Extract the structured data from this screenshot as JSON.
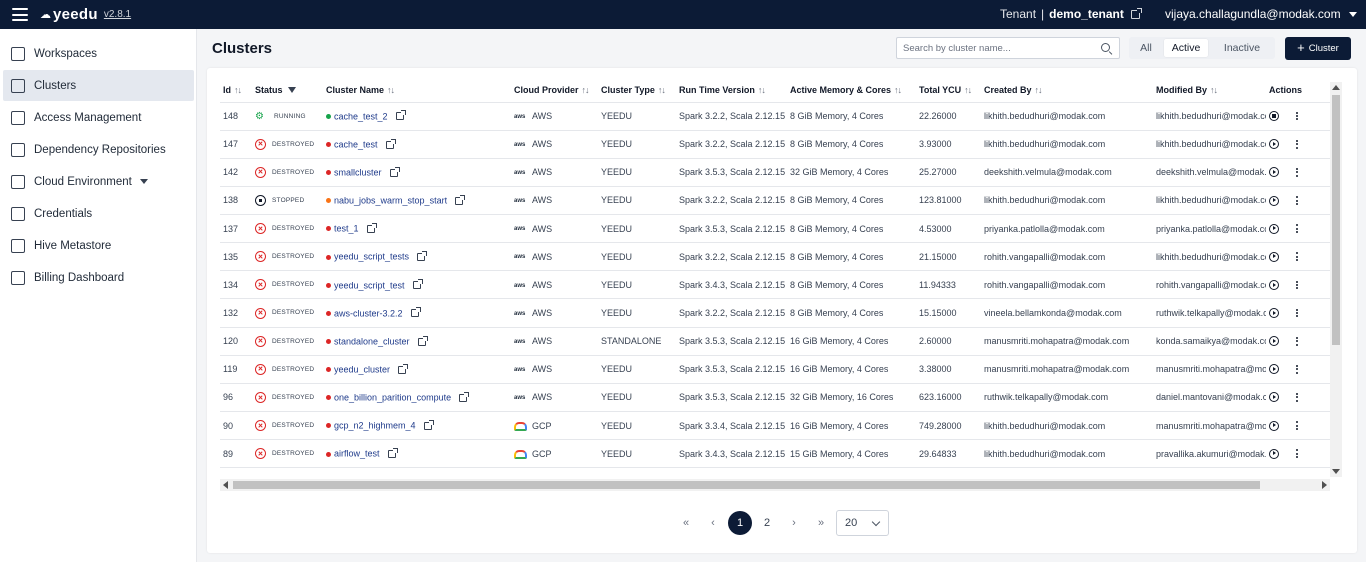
{
  "header": {
    "app_name": "yeedu",
    "version": "v2.8.1",
    "tenant_label": "Tenant",
    "tenant_sep": "|",
    "tenant_name": "demo_tenant",
    "user_email": "vijaya.challagundla@modak.com"
  },
  "sidebar": {
    "items": [
      {
        "label": "Workspaces",
        "icon": "workspace-icon"
      },
      {
        "label": "Clusters",
        "icon": "chart-icon",
        "active": true
      },
      {
        "label": "Access Management",
        "icon": "id-card-icon"
      },
      {
        "label": "Dependency Repositories",
        "icon": "repository-icon"
      },
      {
        "label": "Cloud Environment",
        "icon": "cloud-icon",
        "expandable": true
      },
      {
        "label": "Credentials",
        "icon": "lock-icon"
      },
      {
        "label": "Hive Metastore",
        "icon": "bank-icon"
      },
      {
        "label": "Billing Dashboard",
        "icon": "receipt-icon"
      }
    ]
  },
  "main": {
    "title": "Clusters",
    "search_placeholder": "Search by cluster name...",
    "filters": [
      "All",
      "Active",
      "Inactive"
    ],
    "selected_filter": "Active",
    "add_button": "Cluster",
    "columns": [
      "Id",
      "Status",
      "Cluster Name",
      "Cloud Provider",
      "Cluster Type",
      "Run Time Version",
      "Active Memory & Cores",
      "Total YCU",
      "Created By",
      "Modified By",
      "Actions"
    ],
    "rows": [
      {
        "id": "148",
        "status": "RUNNING",
        "name": "cache_test_2",
        "provider": "AWS",
        "type": "YEEDU",
        "runtime": "Spark 3.2.2, Scala 2.12.15",
        "memory": "8 GiB Memory, 4 Cores",
        "ycu": "22.26000",
        "created_by": "likhith.bedudhuri@modak.com",
        "modified_by": "likhith.bedudhuri@modak.com"
      },
      {
        "id": "147",
        "status": "DESTROYED",
        "name": "cache_test",
        "provider": "AWS",
        "type": "YEEDU",
        "runtime": "Spark 3.2.2, Scala 2.12.15",
        "memory": "8 GiB Memory, 4 Cores",
        "ycu": "3.93000",
        "created_by": "likhith.bedudhuri@modak.com",
        "modified_by": "likhith.bedudhuri@modak.com"
      },
      {
        "id": "142",
        "status": "DESTROYED",
        "name": "smallcluster",
        "provider": "AWS",
        "type": "YEEDU",
        "runtime": "Spark 3.5.3, Scala 2.12.15",
        "memory": "32 GiB Memory, 4 Cores",
        "ycu": "25.27000",
        "created_by": "deekshith.velmula@modak.com",
        "modified_by": "deekshith.velmula@modak.com"
      },
      {
        "id": "138",
        "status": "STOPPED",
        "name": "nabu_jobs_warm_stop_start",
        "provider": "AWS",
        "type": "YEEDU",
        "runtime": "Spark 3.2.2, Scala 2.12.15",
        "memory": "8 GiB Memory, 4 Cores",
        "ycu": "123.81000",
        "created_by": "likhith.bedudhuri@modak.com",
        "modified_by": "likhith.bedudhuri@modak.com"
      },
      {
        "id": "137",
        "status": "DESTROYED",
        "name": "test_1",
        "provider": "AWS",
        "type": "YEEDU",
        "runtime": "Spark 3.5.3, Scala 2.12.15",
        "memory": "8 GiB Memory, 4 Cores",
        "ycu": "4.53000",
        "created_by": "priyanka.patlolla@modak.com",
        "modified_by": "priyanka.patlolla@modak.com"
      },
      {
        "id": "135",
        "status": "DESTROYED",
        "name": "yeedu_script_tests",
        "provider": "AWS",
        "type": "YEEDU",
        "runtime": "Spark 3.2.2, Scala 2.12.15",
        "memory": "8 GiB Memory, 4 Cores",
        "ycu": "21.15000",
        "created_by": "rohith.vangapalli@modak.com",
        "modified_by": "likhith.bedudhuri@modak.com"
      },
      {
        "id": "134",
        "status": "DESTROYED",
        "name": "yeedu_script_test",
        "provider": "AWS",
        "type": "YEEDU",
        "runtime": "Spark 3.4.3, Scala 2.12.15",
        "memory": "8 GiB Memory, 4 Cores",
        "ycu": "11.94333",
        "created_by": "rohith.vangapalli@modak.com",
        "modified_by": "rohith.vangapalli@modak.com"
      },
      {
        "id": "132",
        "status": "DESTROYED",
        "name": "aws-cluster-3.2.2",
        "provider": "AWS",
        "type": "YEEDU",
        "runtime": "Spark 3.2.2, Scala 2.12.15",
        "memory": "8 GiB Memory, 4 Cores",
        "ycu": "15.15000",
        "created_by": "vineela.bellamkonda@modak.com",
        "modified_by": "ruthwik.telkapally@modak.com"
      },
      {
        "id": "120",
        "status": "DESTROYED",
        "name": "standalone_cluster",
        "provider": "AWS",
        "type": "STANDALONE",
        "runtime": "Spark 3.5.3, Scala 2.12.15",
        "memory": "16 GiB Memory, 4 Cores",
        "ycu": "2.60000",
        "created_by": "manusmriti.mohapatra@modak.com",
        "modified_by": "konda.samaikya@modak.com"
      },
      {
        "id": "119",
        "status": "DESTROYED",
        "name": "yeedu_cluster",
        "provider": "AWS",
        "type": "YEEDU",
        "runtime": "Spark 3.5.3, Scala 2.12.15",
        "memory": "16 GiB Memory, 4 Cores",
        "ycu": "3.38000",
        "created_by": "manusmriti.mohapatra@modak.com",
        "modified_by": "manusmriti.mohapatra@modak.com"
      },
      {
        "id": "96",
        "status": "DESTROYED",
        "name": "one_billion_parition_compute",
        "provider": "AWS",
        "type": "YEEDU",
        "runtime": "Spark 3.5.3, Scala 2.12.15",
        "memory": "32 GiB Memory, 16 Cores",
        "ycu": "623.16000",
        "created_by": "ruthwik.telkapally@modak.com",
        "modified_by": "daniel.mantovani@modak.com"
      },
      {
        "id": "90",
        "status": "DESTROYED",
        "name": "gcp_n2_highmem_4",
        "provider": "GCP",
        "type": "YEEDU",
        "runtime": "Spark 3.3.4, Scala 2.12.15",
        "memory": "16 GiB Memory, 4 Cores",
        "ycu": "749.28000",
        "created_by": "likhith.bedudhuri@modak.com",
        "modified_by": "manusmriti.mohapatra@modak.com"
      },
      {
        "id": "89",
        "status": "DESTROYED",
        "name": "airflow_test",
        "provider": "GCP",
        "type": "YEEDU",
        "runtime": "Spark 3.4.3, Scala 2.12.15",
        "memory": "15 GiB Memory, 4 Cores",
        "ycu": "29.64833",
        "created_by": "likhith.bedudhuri@modak.com",
        "modified_by": "pravallika.akumuri@modak.com"
      }
    ],
    "status_colors": {
      "RUNNING": "#16a34a",
      "DESTROYED": "#dc2626",
      "STOPPED": "#f97316"
    },
    "pagination": {
      "pages": [
        "1",
        "2"
      ],
      "current_page": "1",
      "page_size": "20",
      "first": "«",
      "prev": "‹",
      "next": "›",
      "last": "»"
    }
  }
}
